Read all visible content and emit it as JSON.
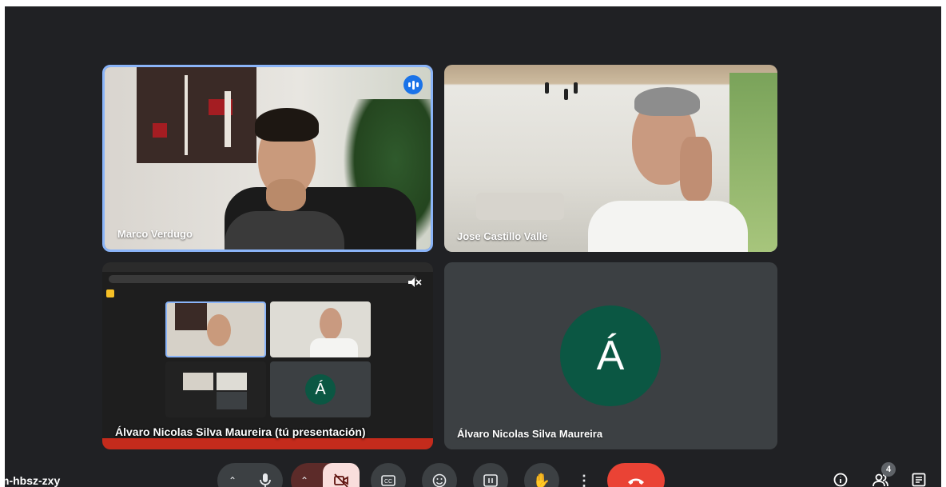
{
  "participants": {
    "marco": {
      "name": "Marco Verdugo"
    },
    "jose": {
      "name": "Jose Castillo Valle"
    },
    "presentation": {
      "label": "Álvaro Nicolas Silva Maureira (tú presentación)"
    },
    "alvaro": {
      "name": "Álvaro Nicolas Silva Maureira",
      "initial": "Á"
    }
  },
  "meeting": {
    "code": "m-hbsz-zxy"
  },
  "people_count": "4",
  "icons": {
    "speaking": "audio-level-icon",
    "mic": "mic-icon",
    "camera": "camera-off-icon",
    "captions": "captions-icon",
    "emoji": "emoji-icon",
    "present": "present-icon",
    "hand": "raise-hand-icon",
    "more": "more-vert-icon",
    "leave": "call-end-icon",
    "info": "info-icon",
    "people": "people-icon",
    "chat": "chat-icon"
  },
  "colors": {
    "background": "#202124",
    "avatar": "#0b5743",
    "leave": "#ea4335",
    "speaking_border": "#8ab4f8"
  }
}
